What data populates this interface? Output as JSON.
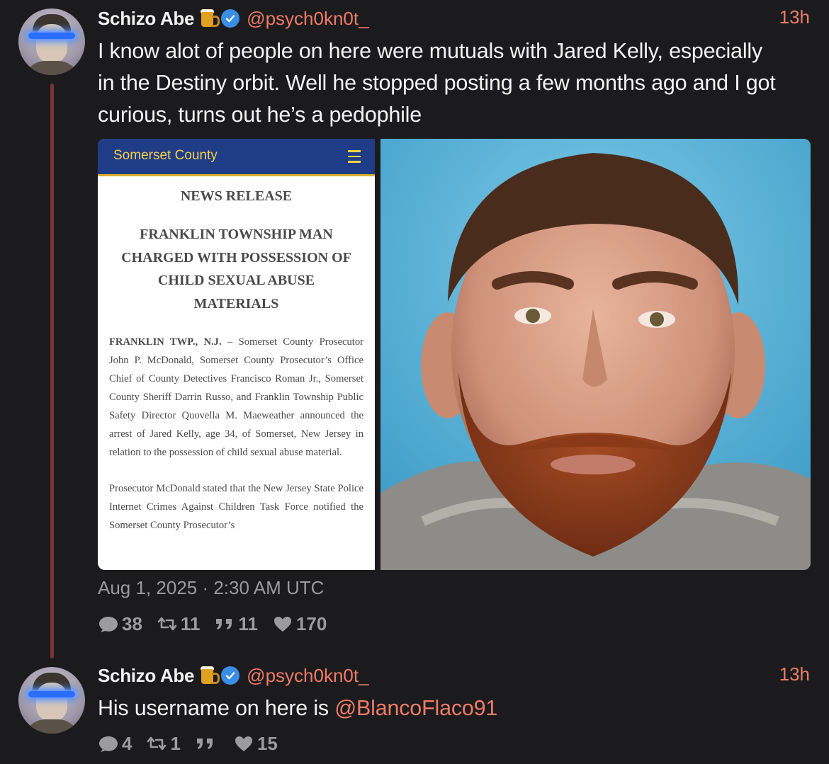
{
  "posts": [
    {
      "author_name": "Schizo Abe",
      "author_handle": "@psych0kn0t_",
      "time_ago": "13h",
      "text": "I know alot of people on here were mutuals with Jared Kelly, especially in the Destiny orbit. Well he stopped posting a few months ago and I got curious, turns out he’s a pedophile",
      "media": {
        "document": {
          "site_name": "Somerset County",
          "label": "NEWS RELEASE",
          "headline": "FRANKLIN TOWNSHIP MAN CHARGED WITH POSSESSION OF CHILD SEXUAL ABUSE MATERIALS",
          "para1_lead": "FRANKLIN TWP., N.J.",
          "para1_rest": " – Somerset County Prosecutor John P. McDonald, Somerset County Prosecutor’s Office Chief of County Detectives Francisco Roman Jr., Somerset County Sheriff Darrin Russo, and Franklin Township Public Safety Director Quovella M. Maeweather announced the arrest of Jared Kelly, age 34, of Somerset, New Jersey in relation to the possession of child sexual abuse material.",
          "para2": "Prosecutor McDonald stated that the New Jersey State Police Internet Crimes Against Children Task Force notified the Somerset County Prosecutor’s"
        }
      },
      "timestamp": "Aug 1, 2025 · 2:30 AM UTC",
      "stats": {
        "replies": "38",
        "reposts": "11",
        "quotes": "11",
        "likes": "170"
      }
    },
    {
      "author_name": "Schizo Abe",
      "author_handle": "@psych0kn0t_",
      "time_ago": "13h",
      "text_prefix": "His username on here is ",
      "text_mention": "@BlancoFlaco91",
      "stats": {
        "replies": "4",
        "reposts": "1",
        "quotes": "",
        "likes": "15"
      }
    }
  ],
  "colors": {
    "background": "#1b1b1d",
    "accent": "#f07a66",
    "thread_line": "#7a3434",
    "verified": "#3a8ee6"
  }
}
